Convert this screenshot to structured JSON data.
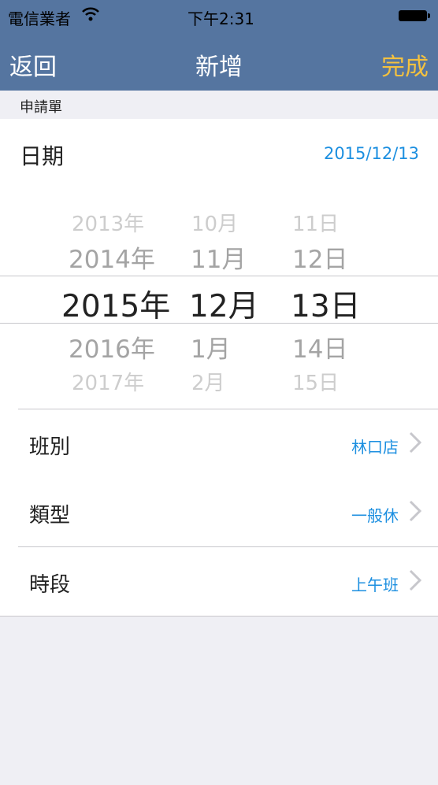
{
  "status_bar": {
    "carrier": "電信業者",
    "time": "下午2:31"
  },
  "nav": {
    "back": "返回",
    "title": "新增",
    "done": "完成"
  },
  "section_header": "申請單",
  "date": {
    "label": "日期",
    "value": "2015/12/13"
  },
  "picker": {
    "years": [
      "2013年",
      "2014年",
      "2015年",
      "2016年",
      "2017年"
    ],
    "months": [
      "10月",
      "11月",
      "12月",
      "1月",
      "2月"
    ],
    "days": [
      "11日",
      "12日",
      "13日",
      "14日",
      "15日"
    ],
    "selected_index": 2
  },
  "rows": [
    {
      "label": "班別",
      "value": "林口店"
    },
    {
      "label": "類型",
      "value": "一般休"
    },
    {
      "label": "時段",
      "value": "上午班"
    }
  ],
  "colors": {
    "nav_bg": "#5575a0",
    "accent": "#1c8fe0",
    "done": "#f3c140"
  }
}
